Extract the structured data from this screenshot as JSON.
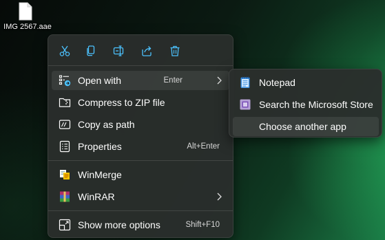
{
  "desktop": {
    "file": {
      "label": "IMG 2567.aae",
      "icon": "document-file-icon"
    }
  },
  "context_menu": {
    "quick_actions": [
      {
        "name": "cut",
        "icon": "scissors-icon"
      },
      {
        "name": "copy",
        "icon": "copy-icon"
      },
      {
        "name": "rename",
        "icon": "rename-icon"
      },
      {
        "name": "share",
        "icon": "share-icon"
      },
      {
        "name": "delete",
        "icon": "trash-icon"
      }
    ],
    "items": {
      "open_with": {
        "label": "Open with",
        "shortcut": "Enter",
        "icon": "open-with-icon",
        "has_submenu": true
      },
      "compress": {
        "label": "Compress to ZIP file",
        "icon": "zip-folder-icon"
      },
      "copy_path": {
        "label": "Copy as path",
        "icon": "path-icon"
      },
      "properties": {
        "label": "Properties",
        "shortcut": "Alt+Enter",
        "icon": "properties-icon"
      },
      "winmerge": {
        "label": "WinMerge",
        "icon": "winmerge-icon"
      },
      "winrar": {
        "label": "WinRAR",
        "icon": "winrar-icon",
        "has_submenu": true
      },
      "more_options": {
        "label": "Show more options",
        "shortcut": "Shift+F10",
        "icon": "more-options-icon"
      }
    }
  },
  "submenu": {
    "items": {
      "notepad": {
        "label": "Notepad",
        "icon": "notepad-icon"
      },
      "store": {
        "label": "Search the Microsoft Store",
        "icon": "store-icon"
      },
      "choose": {
        "label": "Choose another app"
      }
    }
  },
  "colors": {
    "accent": "#4cc2ff",
    "menu_bg": "#2a2e2c",
    "text": "#ffffff"
  }
}
